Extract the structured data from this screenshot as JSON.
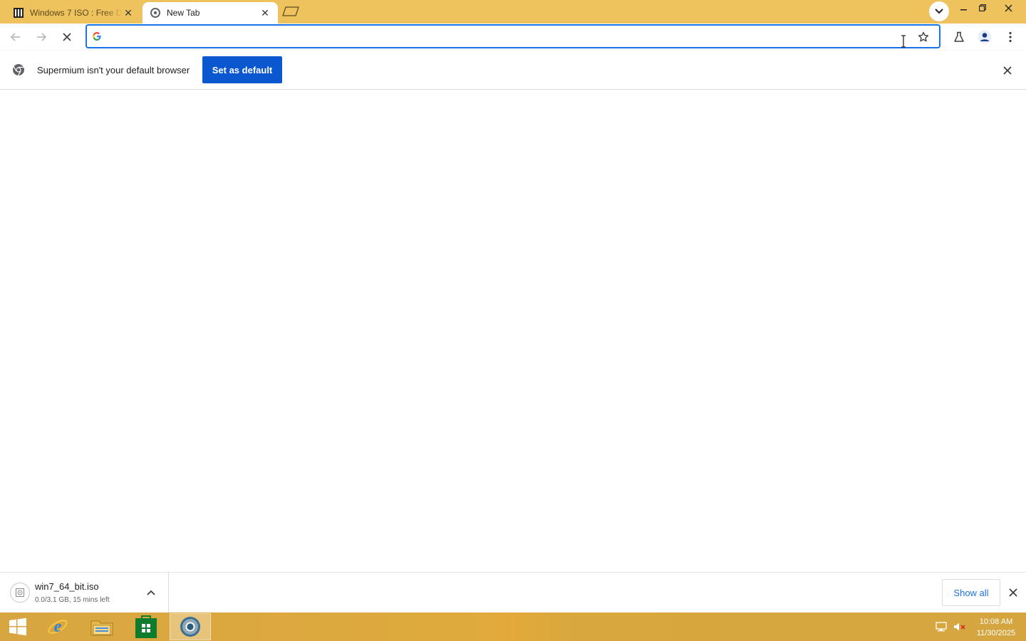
{
  "tabs": [
    {
      "title": "Windows 7 ISO : Free D",
      "favicon": "archive-icon",
      "active": false
    },
    {
      "title": "New Tab",
      "favicon": "supermium-icon",
      "active": true
    }
  ],
  "toolbar": {
    "omnibox_value": "",
    "omnibox_icon": "google-g-icon"
  },
  "infobar": {
    "message": "Supermium isn't your default browser",
    "button_label": "Set as default"
  },
  "downloads": {
    "items": [
      {
        "filename": "win7_64_bit.iso",
        "status": "0.0/3.1 GB, 15 mins left"
      }
    ],
    "show_all_label": "Show all"
  },
  "taskbar": {
    "apps": [
      "windows-start-icon",
      "internet-explorer-icon",
      "file-explorer-icon",
      "store-icon",
      "supermium-browser-icon"
    ],
    "clock": {
      "time": "10:08 AM",
      "date": "11/30/2025"
    }
  },
  "colors": {
    "titlebar": "#eec25c",
    "accent": "#0b57d0",
    "taskbar": "#d9a63e"
  }
}
